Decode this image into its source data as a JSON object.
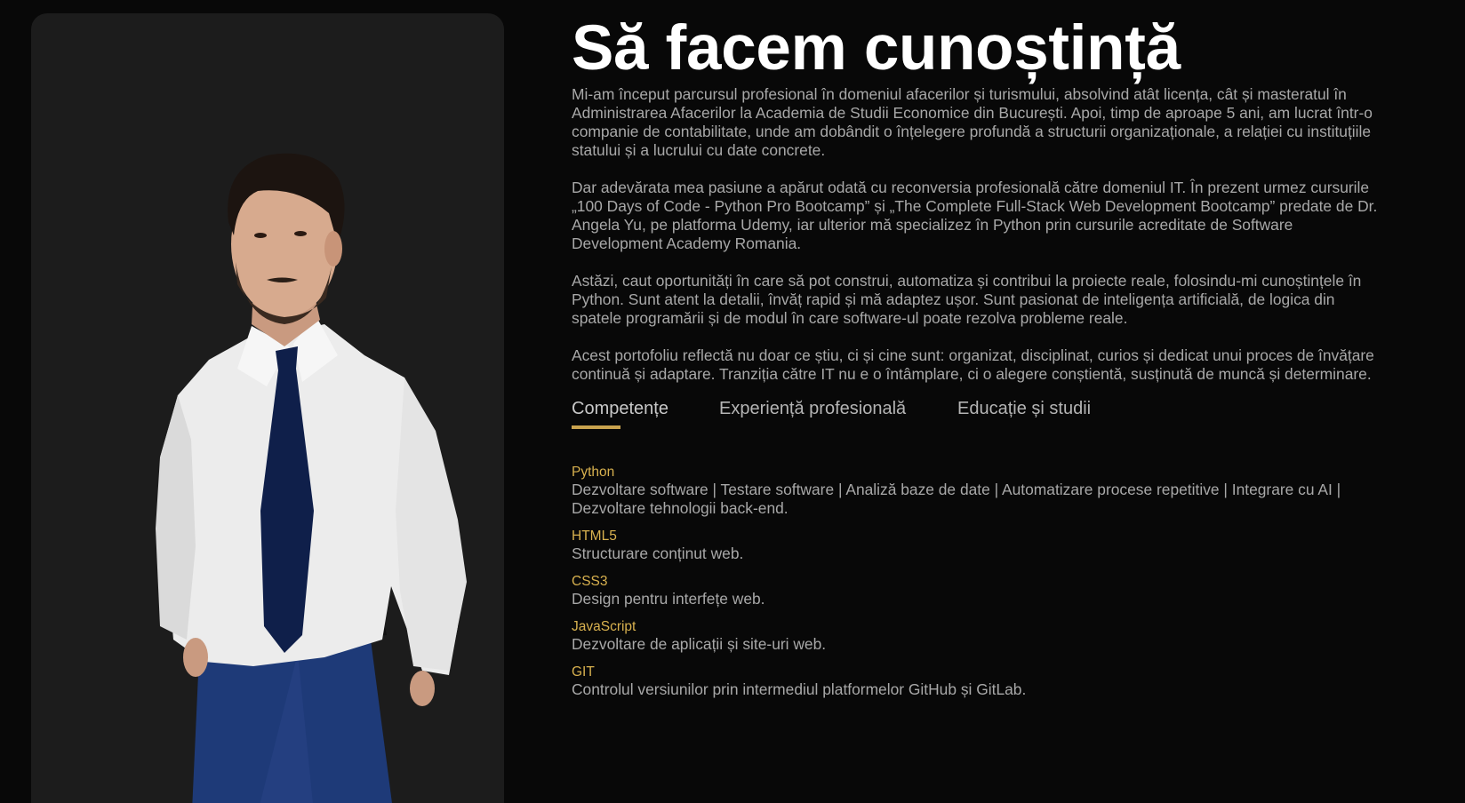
{
  "about": {
    "title": "Să facem cunoștință",
    "paragraphs": [
      "Mi-am început parcursul profesional în domeniul afacerilor și turismului, absolvind atât licența, cât și masteratul în Administrarea Afacerilor la Academia de Studii Economice din București. Apoi, timp de aproape 5 ani, am lucrat într-o companie de contabilitate, unde am dobândit o înțelegere profundă a structurii organizaționale, a relației cu instituțiile statului și a lucrului cu date concrete.",
      "Dar adevărata mea pasiune a apărut odată cu reconversia profesională către domeniul IT. În prezent urmez cursurile „100 Days of Code - Python Pro Bootcamp” și „The Complete Full-Stack Web Development Bootcamp” predate de Dr. Angela Yu, pe platforma Udemy, iar ulterior mă specializez în Python prin cursurile acreditate de Software Development Academy Romania.",
      "Astăzi, caut oportunități în care să pot construi, automatiza și contribui la proiecte reale, folosindu-mi cunoștințele în Python. Sunt atent la detalii, învăț rapid și mă adaptez ușor. Sunt pasionat de inteligența artificială, de logica din spatele programării și de modul în care software-ul poate rezolva probleme reale.",
      "Acest portofoliu reflectă nu doar ce știu, ci și cine sunt: organizat, disciplinat, curios și dedicat unui proces de învățare continuă și adaptare. Tranziția către IT nu e o întâmplare, ci o alegere conștientă, susținută de muncă și determinare."
    ]
  },
  "tabs": [
    {
      "label": "Competențe",
      "active": true
    },
    {
      "label": "Experiență profesională",
      "active": false
    },
    {
      "label": "Educație și studii",
      "active": false
    }
  ],
  "skills": [
    {
      "name": "Python",
      "description": "Dezvoltare software | Testare software | Analiză baze de date | Automatizare procese repetitive | Integrare cu AI | Dezvoltare tehnologii back-end."
    },
    {
      "name": "HTML5",
      "description": "Structurare conținut web."
    },
    {
      "name": "CSS3",
      "description": "Design pentru interfețe web."
    },
    {
      "name": "JavaScript",
      "description": "Dezvoltare de aplicații și site-uri web."
    },
    {
      "name": "GIT",
      "description": "Controlul versiunilor prin intermediul platformelor GitHub și GitLab."
    }
  ],
  "colors": {
    "background": "#080808",
    "card": "#1c1c1c",
    "accent": "#c9a34e",
    "skill_name": "#d8b14f",
    "text": "#a8a8a8",
    "title": "#ffffff"
  }
}
